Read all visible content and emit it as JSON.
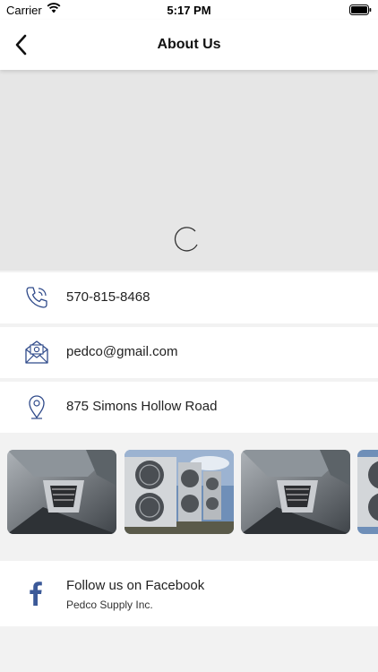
{
  "status_bar": {
    "carrier": "Carrier",
    "time": "5:17 PM",
    "wifi_icon": "wifi-icon",
    "battery_icon": "battery-icon"
  },
  "nav": {
    "title": "About Us",
    "back_icon": "chevron-left-icon"
  },
  "banner": {
    "loading_icon": "spinner-icon"
  },
  "contact": {
    "phone": "570-815-8468",
    "email": "pedco@gmail.com",
    "address": "875  Simons Hollow Road"
  },
  "gallery": {
    "images": [
      "hvac-diffuser-photo",
      "condenser-units-photo",
      "hvac-diffuser-photo",
      "condenser-units-photo"
    ]
  },
  "social": {
    "facebook_label": "Follow us on Facebook",
    "facebook_name": "Pedco Supply Inc."
  },
  "colors": {
    "accent_icon": "#2f4a8a",
    "facebook_blue": "#3b5998",
    "banner_bg": "#e6e6e6"
  }
}
